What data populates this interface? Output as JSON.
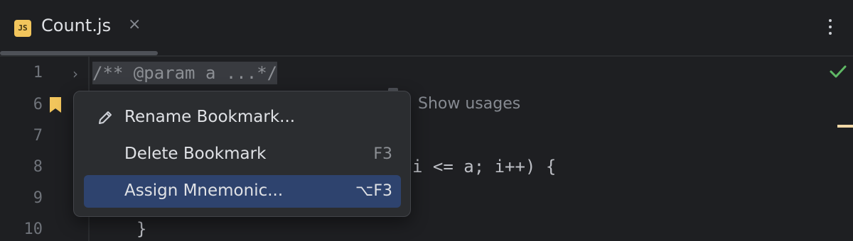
{
  "tab": {
    "file_icon_text": "JS",
    "title": "Count.js",
    "close_glyph": "×"
  },
  "editor": {
    "line_numbers": [
      "1",
      "6",
      "7",
      "8",
      "9",
      "10"
    ],
    "folded_code": "/** @param a ...*/",
    "hint": "Show usages",
    "line8_code": "i <= a; i++) {",
    "line10_code": "}"
  },
  "menu": {
    "items": [
      {
        "label": "Rename Bookmark...",
        "shortcut": "",
        "icon": "pencil-icon"
      },
      {
        "label": "Delete Bookmark",
        "shortcut": "F3"
      },
      {
        "label": "Assign Mnemonic...",
        "shortcut": "⌥F3",
        "selected": true
      }
    ]
  },
  "colors": {
    "background": "#1e1f22",
    "popup": "#2b2d30",
    "selection": "#2e436e",
    "bookmark": "#f2c55c",
    "check": "#5fb865"
  }
}
